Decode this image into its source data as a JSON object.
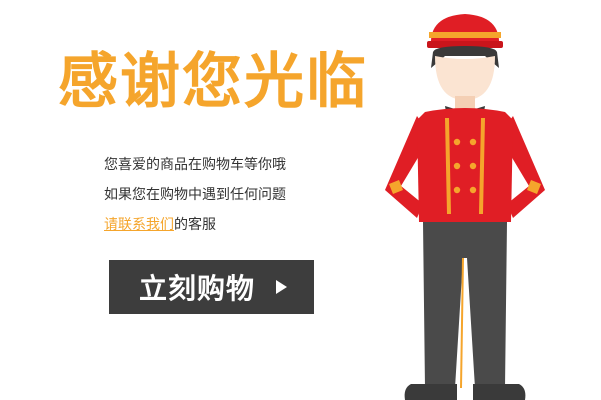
{
  "headline": "感谢您光临",
  "message": {
    "line1": "您喜爱的商品在购物车等你哦",
    "line2": "如果您在购物中遇到任何问题",
    "link_text": "请联系我们",
    "line3_suffix": "的客服"
  },
  "cta": {
    "label": "立刻购物",
    "icon": "chevron-right-icon"
  },
  "illustration": {
    "subject": "bellhop-figure"
  },
  "colors": {
    "accent": "#f5a52c",
    "button_bg": "#3d3d3d",
    "uniform_red": "#e01e25",
    "trousers": "#4a4a4a"
  }
}
